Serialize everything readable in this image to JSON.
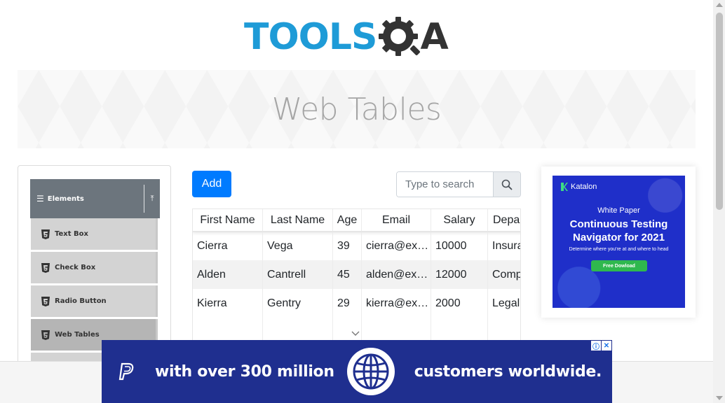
{
  "header": {
    "logo_tools": "TOOLS",
    "logo_a": "A",
    "brand_color": "#1e9bd7"
  },
  "banner": {
    "title": "Web Tables"
  },
  "sidebar": {
    "group_title": "Elements",
    "items": [
      {
        "label": "Text Box",
        "icon": "html5-icon",
        "active": false
      },
      {
        "label": "Check Box",
        "icon": "html5-icon",
        "active": false
      },
      {
        "label": "Radio Button",
        "icon": "html5-icon",
        "active": false
      },
      {
        "label": "Web Tables",
        "icon": "html5-icon",
        "active": true
      }
    ]
  },
  "toolbar": {
    "add_label": "Add",
    "search_placeholder": "Type to search",
    "search_value": ""
  },
  "table": {
    "headers": [
      "First Name",
      "Last Name",
      "Age",
      "Email",
      "Salary",
      "Department"
    ],
    "rows": [
      [
        "Cierra",
        "Vega",
        "39",
        "cierra@example.com",
        "10000",
        "Insurance"
      ],
      [
        "Alden",
        "Cantrell",
        "45",
        "alden@example.com",
        "12000",
        "Compliance"
      ],
      [
        "Kierra",
        "Gentry",
        "29",
        "kierra@example.com",
        "2000",
        "Legal"
      ]
    ]
  },
  "side_ad": {
    "brand": "Katalon",
    "kicker": "White Paper",
    "title_line1": "Continuous Testing",
    "title_line2": "Navigator for 2021",
    "subtitle": "Determine where you're at and where to head",
    "cta": "Free Dowload"
  },
  "bottom_ad": {
    "text1": "with over 300 million",
    "text2": "customers worldwide.",
    "bg_color": "#1f2f8f"
  },
  "colors": {
    "primary": "#007bff",
    "sidebar_header": "#6c757d"
  }
}
